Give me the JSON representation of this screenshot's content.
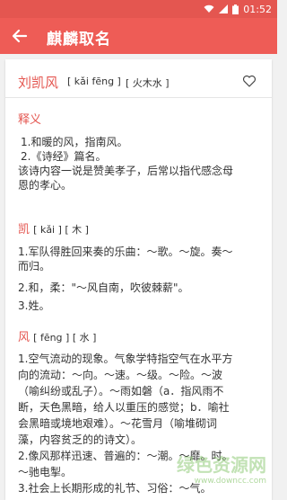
{
  "status": {
    "time": "01:52"
  },
  "appbar": {
    "title": "麒麟取名"
  },
  "name": {
    "text": "刘凯风",
    "pinyin": "[ kǎi fēng ]",
    "wuxing": "[ 火木水 ]"
  },
  "shiyi": {
    "title": "释义",
    "lines": [
      "1.和暖的风，指南风。",
      "2.《诗经》篇名。",
      "该诗内容一说是赞美孝子，后常以指代感念母",
      "恩的孝心。"
    ]
  },
  "kai": {
    "char": "凯",
    "meta": "[ kǎi ] [ 木 ]",
    "lines": [
      "1.军队得胜回来奏的乐曲：～歌。～旋。奏～",
      "而归。",
      "2.和，柔：\"～风自南，吹彼棘薪\"。",
      "3.姓。"
    ]
  },
  "feng": {
    "char": "风",
    "meta": "[ fēng ] [ 水 ]",
    "lines": [
      "1.空气流动的现象。气象学特指空气在水平方",
      "向的流动：～向。～速。～级。～险。～波",
      "（喻纠纷或乱子）。～雨如磐（a．指风雨不",
      "断，天色黑暗，给人以重压的感觉；b．喻社",
      "会黑暗或境地艰难）。～花雪月（喻堆砌词",
      "藻，内容贫乏的的诗文）。",
      "2.像风那样迅速、普遍的：～潮。～靡。时。",
      "～驰电掣。",
      "3.社会上长期形成的礼节、习俗：～气。"
    ]
  },
  "watermark": {
    "text": "绿色资源网",
    "url": "www.downcc.com"
  }
}
